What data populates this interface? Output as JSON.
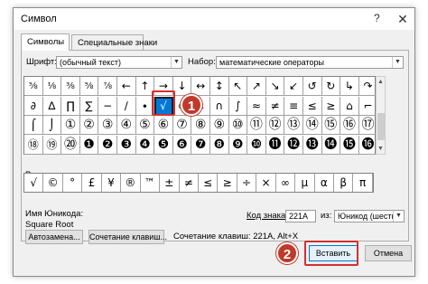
{
  "dialog": {
    "title": "Символ",
    "help": "?",
    "close": "✕"
  },
  "tabs": [
    "Символы",
    "Специальные знаки"
  ],
  "font_label": "Шрифт:",
  "font_value": "(обычный текст)",
  "subset_label": "Набор:",
  "subset_value": "математические операторы",
  "grid_rows": [
    [
      "⅝",
      "⅛",
      "⅜",
      "⅝",
      "⅞",
      "←",
      "↑",
      "→",
      "↓",
      "↔",
      "↕",
      "↖",
      "↗",
      "↘",
      "↙",
      "↺",
      "↻",
      "↳",
      "↷"
    ],
    [
      "∂",
      "∆",
      "∏",
      "∑",
      "−",
      "∕",
      "∙",
      "√",
      "∞",
      "∟",
      "∩",
      "∫",
      "≈",
      "≠",
      "≡",
      "≤",
      "≥",
      "⌂",
      "⌐"
    ],
    [
      "⌠",
      "⌡",
      "①",
      "②",
      "③",
      "④",
      "⑤",
      "⑥",
      "⑦",
      "⑧",
      "⑨",
      "⑩",
      "⑪",
      "⑫",
      "⑬",
      "⑭",
      "⑮",
      "⑯",
      "⑰"
    ],
    [
      "⑱",
      "⑲",
      "⑳",
      "❶",
      "❷",
      "❸",
      "❹",
      "❺",
      "❻",
      "❼",
      "❽",
      "❾",
      "❿",
      "⓫",
      "⓬",
      "⓭",
      "⓮",
      "⓯",
      "⓰"
    ]
  ],
  "recent_label": "Ранее использовавшиеся символы:",
  "recent": [
    "√",
    "©",
    "°",
    "£",
    "¥",
    "®",
    "™",
    "±",
    "≠",
    "≤",
    "≥",
    "÷",
    "×",
    "∞",
    "µ",
    "α",
    "β",
    "π"
  ],
  "unicode_name_label": "Имя Юникода:",
  "unicode_name": "Square Root",
  "code_label": "Код знака:",
  "code_value": "221A",
  "from_label": "из:",
  "from_value": "Юникод (шестн.)",
  "autocorrect_button": "Автозамена...",
  "shortcut_key_button": "Сочетание клавиш...",
  "shortcut_text": "Сочетание клавиш: 221A, Alt+X",
  "insert_button": "Вставить",
  "cancel_button": "Отмена",
  "markers": [
    "1",
    "2"
  ],
  "accent_color": "#0078d7",
  "marker_color": "#c0392b"
}
